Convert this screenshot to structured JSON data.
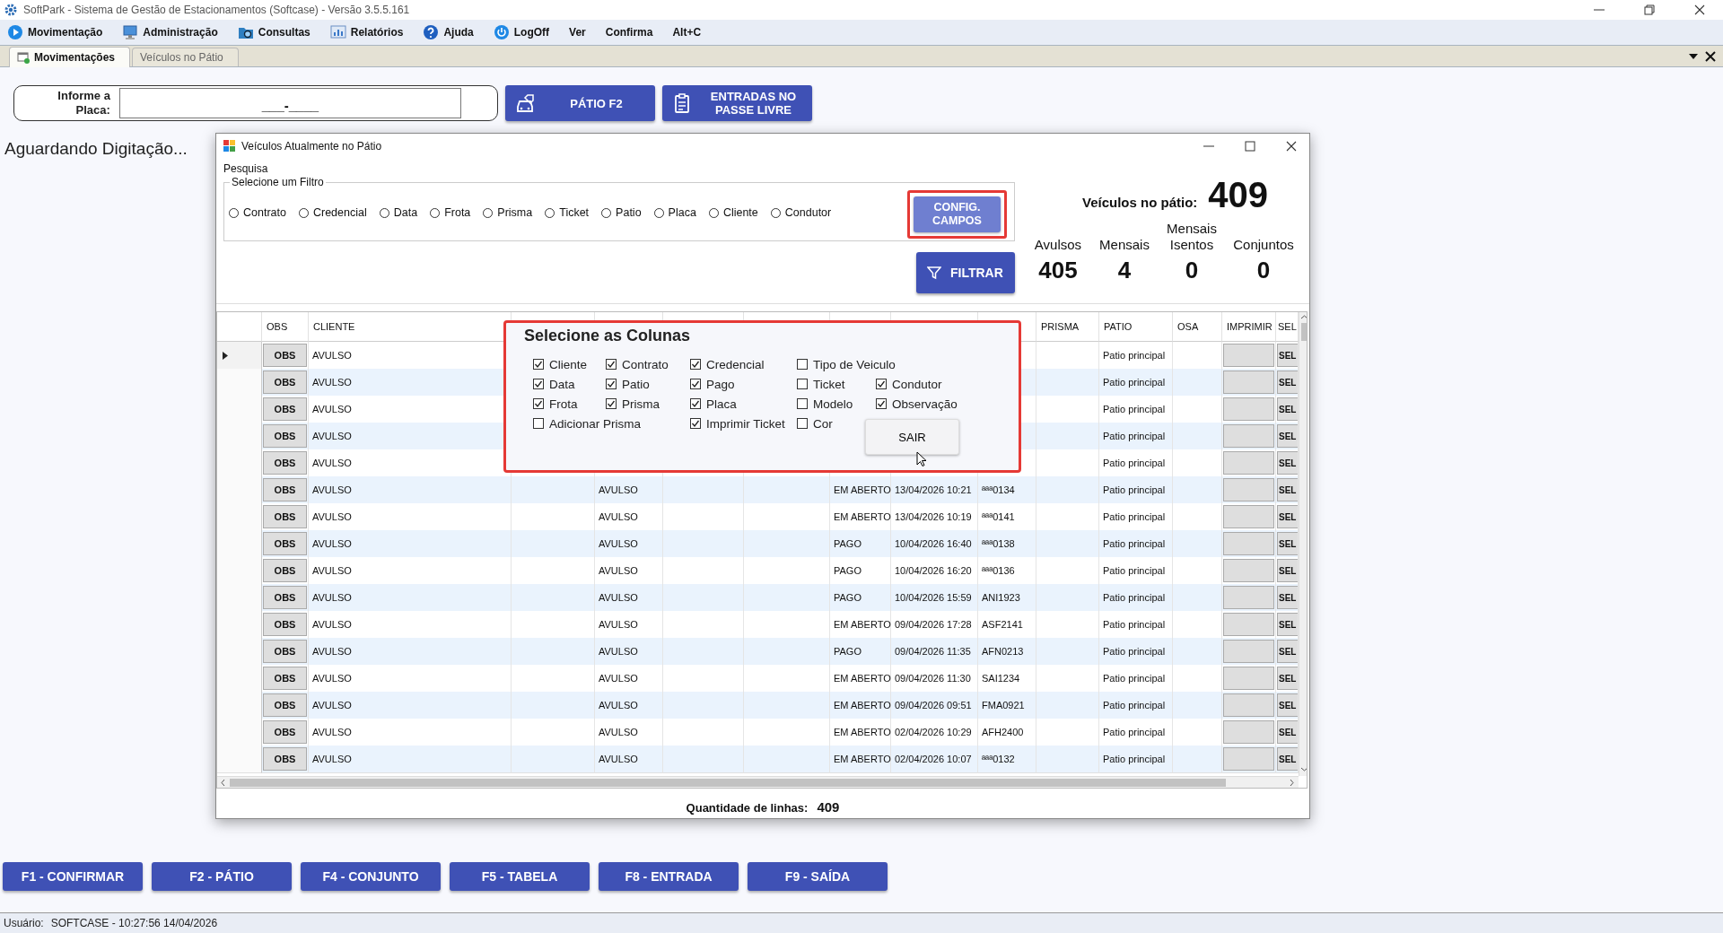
{
  "window": {
    "title": "SoftPark - Sistema de Gestão de Estacionamentos (Softcase) - Versão 3.5.5.161"
  },
  "menu": [
    {
      "label": "Movimentação"
    },
    {
      "label": "Administração"
    },
    {
      "label": "Consultas"
    },
    {
      "label": "Relatórios"
    },
    {
      "label": "Ajuda"
    },
    {
      "label": "LogOff"
    },
    {
      "label": "Ver"
    },
    {
      "label": "Confirma"
    },
    {
      "label": "Alt+C"
    }
  ],
  "tabs": [
    {
      "label": "Movimentações",
      "selected": true
    },
    {
      "label": "Veículos no Pátio",
      "selected": false
    }
  ],
  "placa": {
    "label": "Informe a Placa:",
    "value": "___-____"
  },
  "actions": [
    "PÁTIO F2",
    "ENTRADAS NO PASSE LIVRE"
  ],
  "status_message": "Aguardando Digitação...",
  "dialog": {
    "title": "Veículos Atualmente no Pátio",
    "search_label": "Pesquisa",
    "filter_group": "Selecione um Filtro",
    "filters": [
      {
        "label": "Contrato",
        "selected": false
      },
      {
        "label": "Credencial",
        "selected": false
      },
      {
        "label": "Data",
        "selected": false
      },
      {
        "label": "Frota",
        "selected": false
      },
      {
        "label": "Prisma",
        "selected": false
      },
      {
        "label": "Ticket",
        "selected": false
      },
      {
        "label": "Patio",
        "selected": false
      },
      {
        "label": "Placa",
        "selected": false
      },
      {
        "label": "Cliente",
        "selected": false
      },
      {
        "label": "Condutor",
        "selected": false
      }
    ],
    "config_button": "CONFIG. CAMPOS",
    "filter_button": "FILTRAR",
    "total_label": "Veículos no pátio:",
    "total": "409",
    "stats": [
      {
        "label": "Avulsos",
        "value": "405"
      },
      {
        "label": "Mensais",
        "value": "4"
      },
      {
        "label": "Mensais Isentos",
        "value": "0"
      },
      {
        "label": "Conjuntos",
        "value": "0"
      }
    ],
    "table": {
      "columns": [
        {
          "label": "OBS",
          "kind": "button"
        },
        {
          "label": "CLIENTE",
          "kind": "text"
        },
        {
          "kind": "text"
        },
        {
          "kind": "text"
        },
        {
          "kind": "text"
        },
        {
          "kind": "text"
        },
        {
          "kind": "text"
        },
        {
          "kind": "text"
        },
        {
          "kind": "text"
        },
        {
          "label": "PRISMA",
          "kind": "text"
        },
        {
          "label": "PATIO",
          "kind": "text"
        },
        {
          "label": "OSA",
          "kind": "text"
        },
        {
          "label": "IMPRIMIR",
          "kind": "button"
        },
        {
          "label": "SEL",
          "kind": "button"
        }
      ],
      "rows": [
        {
          "selected": true,
          "cells": [
            "OBS",
            "AVULSO",
            null,
            null,
            null,
            null,
            null,
            null,
            null,
            null,
            "Patio principal",
            null,
            null,
            "SEL"
          ]
        },
        {
          "selected": false,
          "cells": [
            "OBS",
            "AVULSO",
            null,
            null,
            null,
            null,
            null,
            null,
            null,
            null,
            "Patio principal",
            null,
            null,
            "SEL"
          ]
        },
        {
          "selected": false,
          "cells": [
            "OBS",
            "AVULSO",
            null,
            null,
            null,
            null,
            null,
            null,
            null,
            null,
            "Patio principal",
            null,
            null,
            "SEL"
          ]
        },
        {
          "selected": false,
          "cells": [
            "OBS",
            "AVULSO",
            null,
            null,
            null,
            null,
            null,
            null,
            null,
            null,
            "Patio principal",
            null,
            null,
            "SEL"
          ]
        },
        {
          "selected": false,
          "cells": [
            "OBS",
            "AVULSO",
            null,
            null,
            null,
            null,
            null,
            null,
            null,
            null,
            "Patio principal",
            null,
            null,
            "SEL"
          ]
        },
        {
          "selected": false,
          "cells": [
            "OBS",
            "AVULSO",
            null,
            "AVULSO",
            null,
            null,
            "EM ABERTO",
            "13/04/2026 10:21",
            "ªªª0134",
            null,
            "Patio principal",
            null,
            null,
            "SEL"
          ]
        },
        {
          "selected": false,
          "cells": [
            "OBS",
            "AVULSO",
            null,
            "AVULSO",
            null,
            null,
            "EM ABERTO",
            "13/04/2026 10:19",
            "ªªª0141",
            null,
            "Patio principal",
            null,
            null,
            "SEL"
          ]
        },
        {
          "selected": false,
          "cells": [
            "OBS",
            "AVULSO",
            null,
            "AVULSO",
            null,
            null,
            "PAGO",
            "10/04/2026 16:40",
            "ªªª0138",
            null,
            "Patio principal",
            null,
            null,
            "SEL"
          ]
        },
        {
          "selected": false,
          "cells": [
            "OBS",
            "AVULSO",
            null,
            "AVULSO",
            null,
            null,
            "PAGO",
            "10/04/2026 16:20",
            "ªªª0136",
            null,
            "Patio principal",
            null,
            null,
            "SEL"
          ]
        },
        {
          "selected": false,
          "cells": [
            "OBS",
            "AVULSO",
            null,
            "AVULSO",
            null,
            null,
            "PAGO",
            "10/04/2026 15:59",
            "ANI1923",
            null,
            "Patio principal",
            null,
            null,
            "SEL"
          ]
        },
        {
          "selected": false,
          "cells": [
            "OBS",
            "AVULSO",
            null,
            "AVULSO",
            null,
            null,
            "EM ABERTO",
            "09/04/2026 17:28",
            "ASF2141",
            null,
            "Patio principal",
            null,
            null,
            "SEL"
          ]
        },
        {
          "selected": false,
          "cells": [
            "OBS",
            "AVULSO",
            null,
            "AVULSO",
            null,
            null,
            "PAGO",
            "09/04/2026 11:35",
            "AFN0213",
            null,
            "Patio principal",
            null,
            null,
            "SEL"
          ]
        },
        {
          "selected": false,
          "cells": [
            "OBS",
            "AVULSO",
            null,
            "AVULSO",
            null,
            null,
            "EM ABERTO",
            "09/04/2026 11:30",
            "SAI1234",
            null,
            "Patio principal",
            null,
            null,
            "SEL"
          ]
        },
        {
          "selected": false,
          "cells": [
            "OBS",
            "AVULSO",
            null,
            "AVULSO",
            null,
            null,
            "EM ABERTO",
            "09/04/2026 09:51",
            "FMA0921",
            null,
            "Patio principal",
            null,
            null,
            "SEL"
          ]
        },
        {
          "selected": false,
          "cells": [
            "OBS",
            "AVULSO",
            null,
            "AVULSO",
            null,
            null,
            "EM ABERTO",
            "02/04/2026 10:29",
            "AFH2400",
            null,
            "Patio principal",
            null,
            null,
            "SEL"
          ]
        },
        {
          "selected": false,
          "cells": [
            "OBS",
            "AVULSO",
            null,
            "AVULSO",
            null,
            null,
            "EM ABERTO",
            "02/04/2026 10:07",
            "ªªª0132",
            null,
            "Patio principal",
            null,
            null,
            "SEL"
          ]
        }
      ]
    },
    "row_count_label": "Quantidade de linhas:",
    "row_count": "409",
    "column_picker": {
      "title": "Selecione as Colunas",
      "close_button": "SAIR",
      "columns": [
        [
          {
            "label": "Cliente",
            "checked": true
          },
          {
            "label": "Data",
            "checked": true
          },
          {
            "label": "Frota",
            "checked": true
          },
          {
            "label": "Adicionar Prisma",
            "checked": false
          }
        ],
        [
          {
            "label": "Contrato",
            "checked": true
          },
          {
            "label": "Patio",
            "checked": true
          },
          {
            "label": "Prisma",
            "checked": true
          }
        ],
        [
          {
            "label": "Credencial",
            "checked": true
          },
          {
            "label": "Pago",
            "checked": true
          },
          {
            "label": "Placa",
            "checked": true
          },
          {
            "label": "Imprimir Ticket",
            "checked": true
          }
        ],
        [
          {
            "label": "Tipo de Veiculo",
            "checked": false
          },
          {
            "label": "Ticket",
            "checked": false
          },
          {
            "label": "Modelo",
            "checked": false
          },
          {
            "label": "Cor",
            "checked": false
          }
        ],
        [
          {
            "label": "Condutor",
            "checked": true
          },
          {
            "label": "Observação",
            "checked": true
          }
        ]
      ]
    }
  },
  "function_keys": [
    "F1 - CONFIRMAR",
    "F2 - PÁTIO",
    "F4 - CONJUNTO",
    "F5 - TABELA",
    "F8 - ENTRADA",
    "F9 - SAÍDA"
  ],
  "status_bar": {
    "user_label": "Usuário:",
    "user": "SOFTCASE - 10:27:56 14/04/2026"
  }
}
